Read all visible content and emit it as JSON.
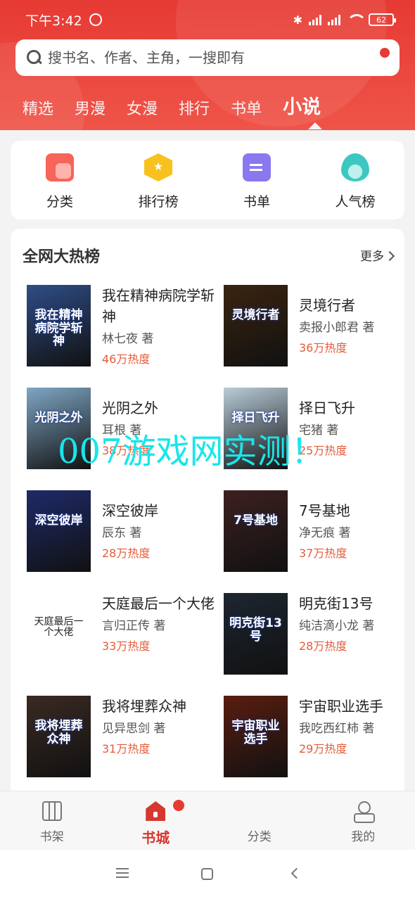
{
  "status_bar": {
    "time": "下午3:42",
    "battery": "62"
  },
  "search": {
    "placeholder": "搜书名、作者、主角，一搜即有"
  },
  "tabs": [
    "精选",
    "男漫",
    "女漫",
    "排行",
    "书单",
    "小说"
  ],
  "active_tab": "小说",
  "quick_links": [
    {
      "label": "分类",
      "icon": "category-icon"
    },
    {
      "label": "排行榜",
      "icon": "ranking-badge-icon"
    },
    {
      "label": "书单",
      "icon": "booklist-icon"
    },
    {
      "label": "人气榜",
      "icon": "popularity-flame-icon"
    }
  ],
  "hot_list": {
    "title": "全网大热榜",
    "more": "更多",
    "books": [
      {
        "title": "我在精神病院学斩神",
        "author": "林七夜 著",
        "heat": "46万热度",
        "cover_text": "我在精神病院学斩神",
        "cover_color": "#2f4d86"
      },
      {
        "title": "灵境行者",
        "author": "卖报小郎君 著",
        "heat": "36万热度",
        "cover_text": "灵境行者",
        "cover_color": "#3a2410"
      },
      {
        "title": "光阴之外",
        "author": "耳根 著",
        "heat": "38万热度",
        "cover_text": "光阴之外",
        "cover_color": "#7fa6c4"
      },
      {
        "title": "择日飞升",
        "author": "宅猪 著",
        "heat": "25万热度",
        "cover_text": "择日飞升",
        "cover_color": "#b8ccd8"
      },
      {
        "title": "深空彼岸",
        "author": "辰东 著",
        "heat": "28万热度",
        "cover_text": "深空彼岸",
        "cover_color": "#1e2a68"
      },
      {
        "title": "7号基地",
        "author": "净无痕 著",
        "heat": "37万热度",
        "cover_text": "7号基地",
        "cover_color": "#3d2020"
      },
      {
        "title": "天庭最后一个大佬",
        "author": "言归正传 著",
        "heat": "33万热度",
        "cover_text": "天庭最后一个大佬",
        "cover_color": "#ffffff"
      },
      {
        "title": "明克街13号",
        "author": "纯洁滴小龙 著",
        "heat": "28万热度",
        "cover_text": "明克街13号",
        "cover_color": "#1d2630"
      },
      {
        "title": "我将埋葬众神",
        "author": "见异思剑 著",
        "heat": "31万热度",
        "cover_text": "我将埋葬众神",
        "cover_color": "#3a2a22"
      },
      {
        "title": "宇宙职业选手",
        "author": "我吃西红柿 著",
        "heat": "29万热度",
        "cover_text": "宇宙职业选手",
        "cover_color": "#5a1d10"
      }
    ]
  },
  "watermark": "007游戏网实测！",
  "bottom_nav": [
    {
      "label": "书架",
      "icon": "bookshelf-icon"
    },
    {
      "label": "书城",
      "icon": "bookstore-home-icon"
    },
    {
      "label": "分类",
      "icon": "category-grid-icon"
    },
    {
      "label": "我的",
      "icon": "profile-icon"
    }
  ],
  "active_nav": "书城",
  "colors": {
    "brand": "#e63a33",
    "heat": "#e65c3a"
  }
}
